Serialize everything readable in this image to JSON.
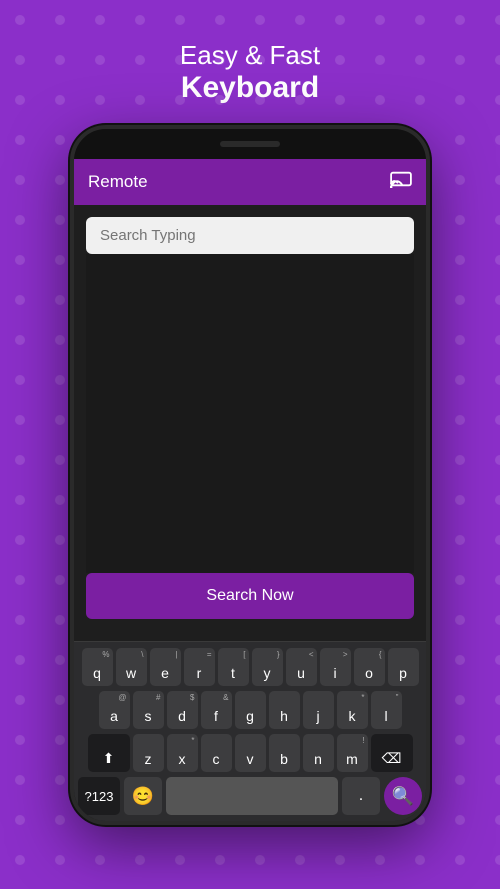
{
  "background_color": "#8B2FC9",
  "header": {
    "line1": "Easy & Fast",
    "line2": "Keyboard"
  },
  "app": {
    "title": "Remote",
    "cast_icon": "⬛",
    "search_placeholder": "Search Typing",
    "search_button_label": "Search Now"
  },
  "keyboard": {
    "row1": [
      {
        "key": "q",
        "sub": "%"
      },
      {
        "key": "w",
        "sub": "\\"
      },
      {
        "key": "e",
        "sub": "|"
      },
      {
        "key": "r",
        "sub": "="
      },
      {
        "key": "t",
        "sub": "["
      },
      {
        "key": "y",
        "sub": "}"
      },
      {
        "key": "u",
        "sub": "<"
      },
      {
        "key": "i",
        "sub": ">"
      },
      {
        "key": "o",
        "sub": "{"
      },
      {
        "key": "p",
        "sub": ""
      }
    ],
    "row2": [
      {
        "key": "a",
        "sub": "@"
      },
      {
        "key": "s",
        "sub": "#"
      },
      {
        "key": "d",
        "sub": "$"
      },
      {
        "key": "f",
        "sub": "&"
      },
      {
        "key": "g",
        "sub": ""
      },
      {
        "key": "h",
        "sub": ""
      },
      {
        "key": "j",
        "sub": ""
      },
      {
        "key": "k",
        "sub": "*"
      },
      {
        "key": "l",
        "sub": "\""
      }
    ],
    "row3_left": "⬆",
    "row3": [
      {
        "key": "z",
        "sub": ""
      },
      {
        "key": "x",
        "sub": "*"
      },
      {
        "key": "c",
        "sub": ""
      },
      {
        "key": "v",
        "sub": ""
      },
      {
        "key": "b",
        "sub": ""
      },
      {
        "key": "n",
        "sub": ""
      },
      {
        "key": "m",
        "sub": "!"
      }
    ],
    "row3_right": "⌫",
    "bottom": {
      "num_label": "?123",
      "comma": ",",
      "period": ".",
      "emoji": "😊"
    }
  }
}
